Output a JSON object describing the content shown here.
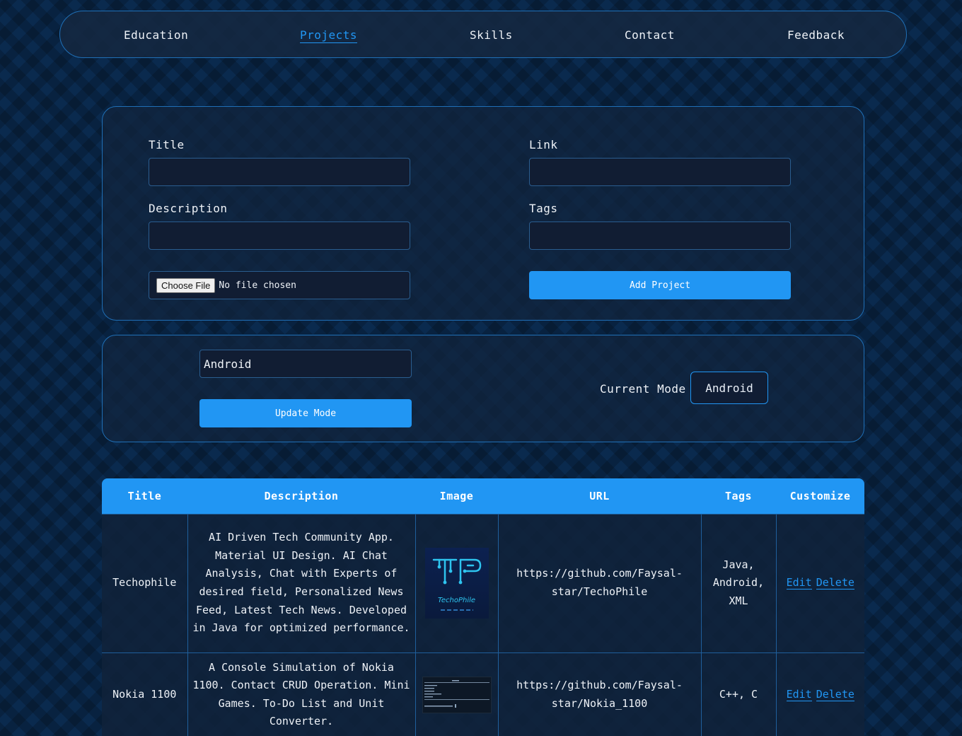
{
  "nav": {
    "items": [
      {
        "label": "Education",
        "active": false
      },
      {
        "label": "Projects",
        "active": true
      },
      {
        "label": "Skills",
        "active": false
      },
      {
        "label": "Contact",
        "active": false
      },
      {
        "label": "Feedback",
        "active": false
      }
    ]
  },
  "project_form": {
    "title_label": "Title",
    "title_value": "",
    "link_label": "Link",
    "link_value": "",
    "description_label": "Description",
    "description_value": "",
    "tags_label": "Tags",
    "tags_value": "",
    "file_button_label": "Choose File",
    "file_status": "No file chosen",
    "submit_label": "Add Project"
  },
  "mode_form": {
    "mode_input_value": "Android",
    "update_label": "Update Mode",
    "current_mode_label": "Current Mode",
    "current_mode_value": "Android"
  },
  "table": {
    "headers": [
      "Title",
      "Description",
      "Image",
      "URL",
      "Tags",
      "Customize"
    ],
    "rows": [
      {
        "title": "Techophile",
        "description": "AI Driven Tech Community App. Material UI Design. AI Chat Analysis, Chat with Experts of desired field, Personalized News Feed, Latest Tech News. Developed in Java for optimized performance.",
        "image_logo_text": "TP",
        "image_caption": "TechoPhile",
        "url": "https://github.com/Faysal-star/TechoPhile",
        "tags": "Java, Android, XML",
        "edit_label": "Edit",
        "delete_label": "Delete"
      },
      {
        "title": "Nokia 1100",
        "description": "A Console Simulation of Nokia 1100. Contact CRUD Operation. Mini Games. To-Do List and Unit Converter.",
        "url": "https://github.com/Faysal-star/Nokia_1100",
        "tags": "C++, C",
        "edit_label": "Edit",
        "delete_label": "Delete"
      }
    ]
  },
  "colors": {
    "accent": "#2196f3",
    "border": "#1f6fb6",
    "input_bg": "#111d33",
    "background": "#0a2a4e"
  }
}
